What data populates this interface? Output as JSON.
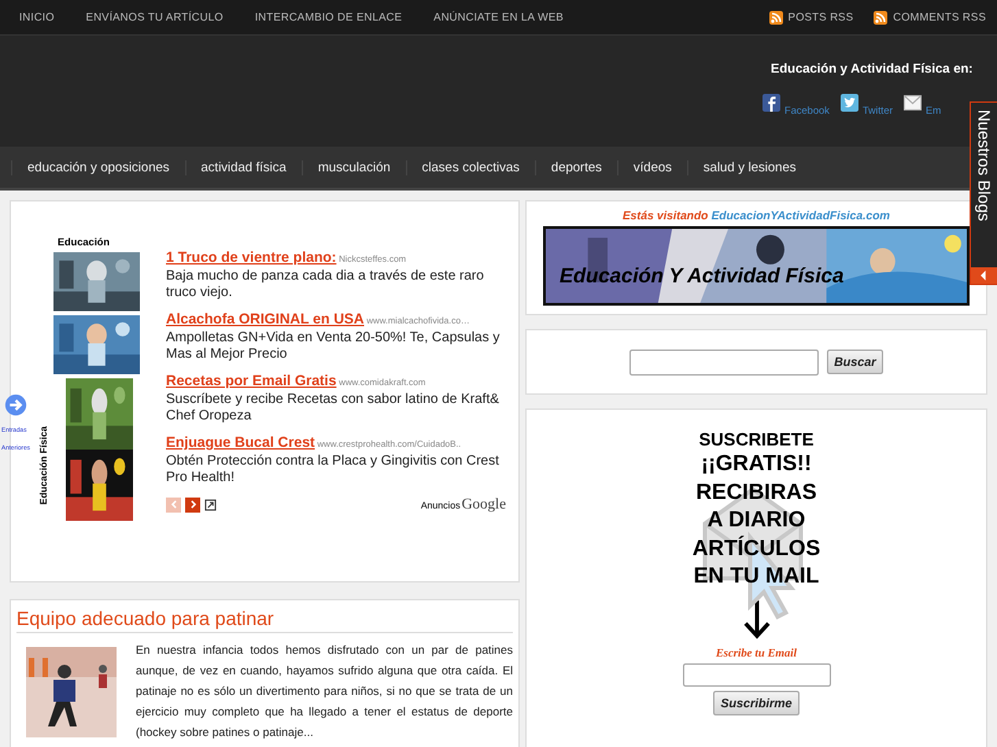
{
  "top_bar": {
    "links": [
      "INICIO",
      "ENVÍANOS TU ARTÍCULO",
      "INTERCAMBIO DE ENLACE",
      "ANÚNCIATE EN LA WEB"
    ],
    "feeds": [
      "POSTS RSS",
      "COMMENTS RSS"
    ]
  },
  "header": {
    "social_title": "Educación y Actividad Física en:",
    "social": [
      {
        "kind": "facebook",
        "label": "Facebook"
      },
      {
        "kind": "twitter",
        "label": "Twitter"
      },
      {
        "kind": "email",
        "label": "Em"
      }
    ]
  },
  "nav": [
    "educación y oposiciones",
    "actividad física",
    "musculación",
    "clases colectivas",
    "deportes",
    "vídeos",
    "salud y lesiones"
  ],
  "side_tab": "Nuestros Blogs",
  "prev_link": "Entradas Anteriores",
  "ads": {
    "thumb_title": "Educación",
    "thumb_caption": "Educación Física",
    "items": [
      {
        "title": "1 Truco de vientre plano:",
        "url": "Nickcsteffes.com",
        "text": "Baja mucho de panza cada dia a través de este raro truco viejo."
      },
      {
        "title": "Alcachofa ORIGINAL en USA",
        "url": "www.mialcachofivida.co…",
        "text": "Ampolletas GN+Vida en Venta 20-50%! Te, Capsulas y Mas al Mejor Precio"
      },
      {
        "title": "Recetas por Email Gratis",
        "url": "www.comidakraft.com",
        "text": "Suscríbete y recibe Recetas con sabor latino de Kraft& Chef Oropeza"
      },
      {
        "title": "Enjuague Bucal Crest",
        "url": "www.crestprohealth.com/CuidadoB..",
        "text": "Obtén Protección contra la Placa y Gingivitis con Crest Pro Health!"
      }
    ],
    "prev_disabled": true,
    "next_disabled": false,
    "footer_label": "Anuncios",
    "footer_brand": "Google"
  },
  "post": {
    "title": "Equipo adecuado para patinar",
    "excerpt": "En nuestra infancia todos hemos disfrutado con un par de patines aunque, de vez en cuando, hayamos sufrido alguna que otra caída. El patinaje no es sólo un divertimento para niños, si no que se trata de un ejercicio muy completo que ha llegado a tener el estatus de deporte (hockey sobre patines o patinaje..."
  },
  "visit": {
    "prefix": "Estás visitando",
    "site": "EducacionYActividadFisica.com",
    "banner_title": "Educación Y Actividad Física"
  },
  "search": {
    "button": "Buscar"
  },
  "subscribe": {
    "lines": [
      "SUSCRIBETE",
      "¡¡GRATIS!!",
      "RECIBIRAS",
      "A DIARIO",
      "ARTÍCULOS",
      "EN TU MAIL"
    ],
    "label": "Escribe tu Email",
    "button": "Suscribirme"
  }
}
